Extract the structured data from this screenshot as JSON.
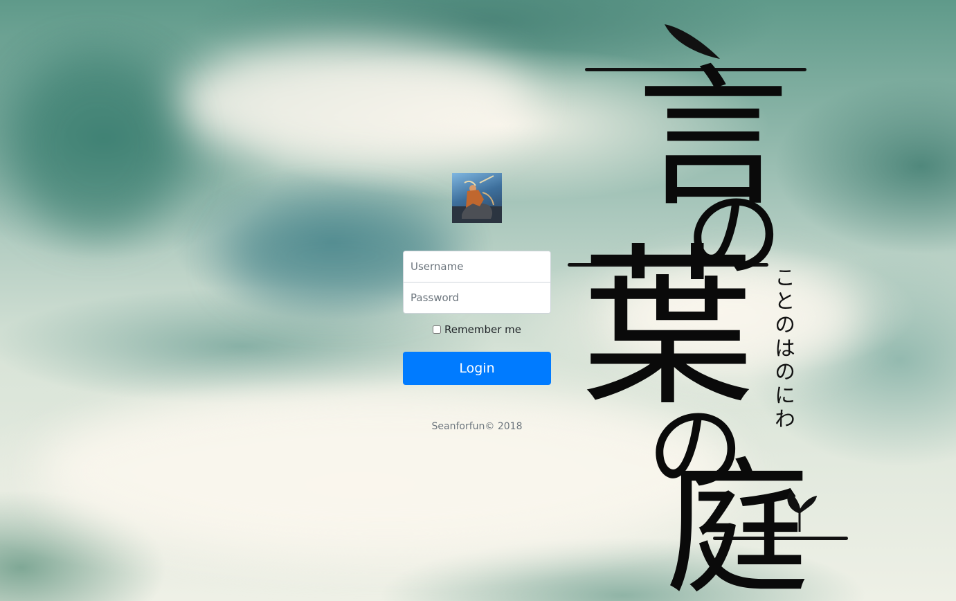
{
  "avatar": {
    "icon": "warrior-avatar-icon"
  },
  "form": {
    "username_placeholder": "Username",
    "password_placeholder": "Password",
    "remember_label": "Remember me",
    "login_label": "Login"
  },
  "footer": {
    "text": "Seanforfun© 2018"
  },
  "title_art": {
    "characters": [
      "言",
      "の",
      "葉",
      "の",
      "庭"
    ],
    "kana": "ことのはのにわ"
  },
  "colors": {
    "primary": "#007bff",
    "ink": "#0a0a0a",
    "muted_text": "#6c757d"
  }
}
